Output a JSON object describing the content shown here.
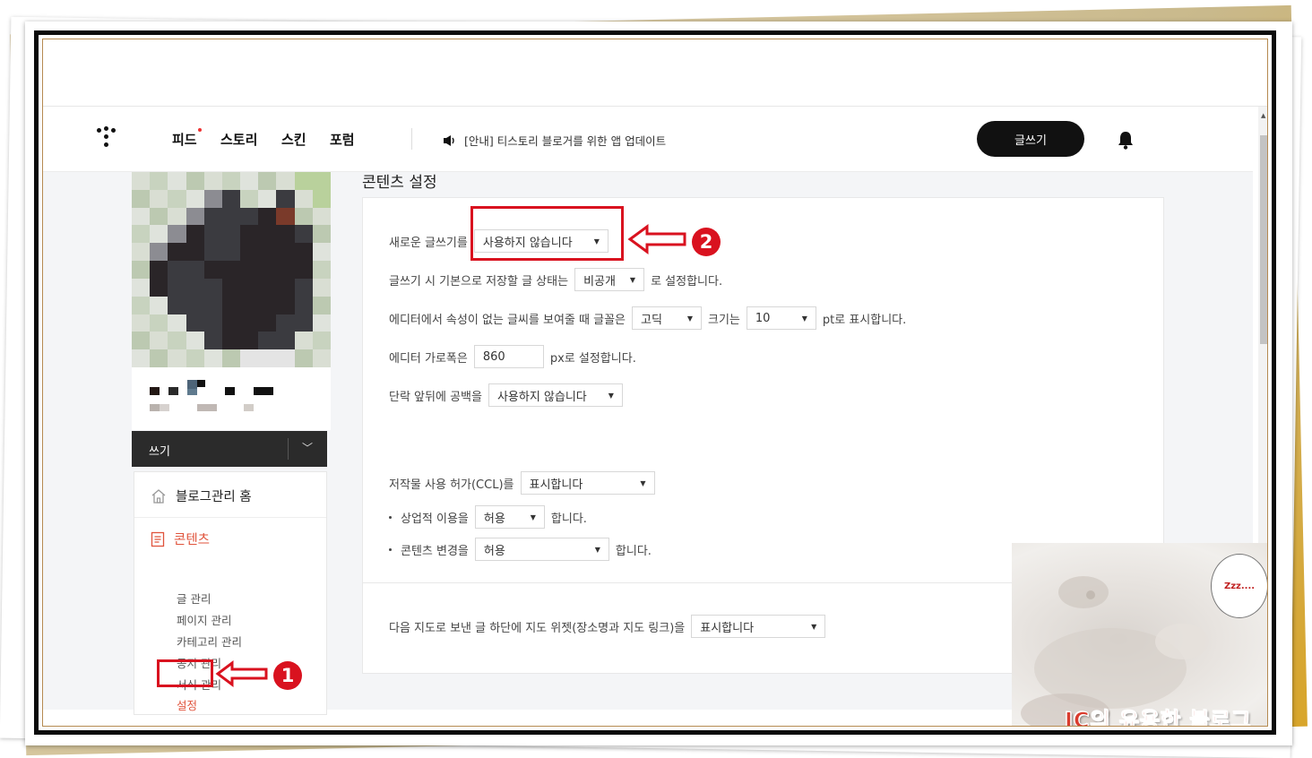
{
  "header": {
    "nav": [
      "피드",
      "스토리",
      "스킨",
      "포럼"
    ],
    "notice": "[안내] 티스토리 블로거를 위한 앱 업데이트",
    "write_button": "글쓰기"
  },
  "sidebar": {
    "write_label": "쓰기",
    "home_label": "블로그관리 홈",
    "section_label": "콘텐츠",
    "items": [
      "글 관리",
      "페이지 관리",
      "카테고리 관리",
      "공지 관리",
      "서식 관리",
      "설정"
    ],
    "active_item": "설정"
  },
  "main": {
    "title": "콘텐츠 설정",
    "editor": {
      "new_editor_label": "새로운 글쓰기를",
      "new_editor_value": "사용하지 않습니다",
      "default_state_prefix": "글쓰기 시 기본으로 저장할 글 상태는",
      "default_state_value": "비공개",
      "default_state_suffix": "로 설정합니다.",
      "font_prefix": "에디터에서 속성이 없는 글씨를 보여줄 때 글꼴은",
      "font_value": "고딕",
      "size_label": "크기는",
      "size_value": "10",
      "size_suffix": "pt로 표시합니다.",
      "width_prefix": "에디터 가로폭은",
      "width_value": "860",
      "width_suffix": "px로 설정합니다.",
      "spacing_prefix": "단락 앞뒤에 공백을",
      "spacing_value": "사용하지 않습니다"
    },
    "ccl": {
      "label": "저작물 사용 허가(CCL)를",
      "value": "표시합니다",
      "commercial_label": "상업적 이용을",
      "commercial_value": "허용",
      "commercial_suffix": "합니다.",
      "modify_label": "콘텐츠 변경을",
      "modify_value": "허용",
      "modify_suffix": "합니다."
    },
    "map": {
      "label": "다음 지도로 보낸 글 하단에 지도 위젯(장소명과 지도 링크)을",
      "value": "표시합니다"
    }
  },
  "annotations": {
    "step1": "1",
    "step2": "2"
  },
  "sticker": {
    "bubble": "Zzz....",
    "watermark": "JC의 유용한 블로그"
  },
  "colors": {
    "accent": "#e0533b",
    "annotation_red": "#d9121f",
    "header_button": "#111111"
  }
}
